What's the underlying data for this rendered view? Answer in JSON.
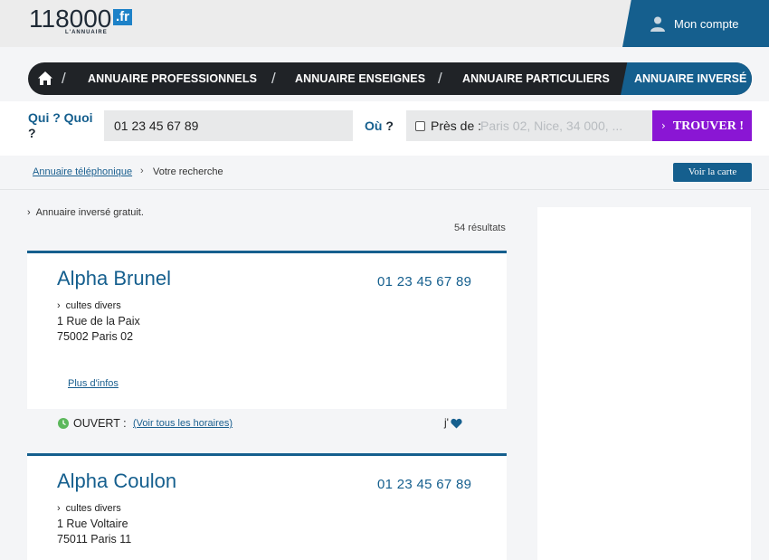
{
  "header": {
    "logo_digits": "118000",
    "logo_fr": ".fr",
    "logo_sub": "L'ANNUAIRE",
    "account_label": "Mon compte"
  },
  "nav": {
    "items": [
      "ANNUAIRE PROFESSIONNELS",
      "ANNUAIRE ENSEIGNES",
      "ANNUAIRE PARTICULIERS"
    ],
    "active": "ANNUAIRE INVERSÉ"
  },
  "search": {
    "qui_label_a": "Qui ?",
    "qui_label_b": "Quoi",
    "qui_label_c": "?",
    "qui_value": "01 23 45 67 89",
    "ou_label_a": "Où",
    "ou_label_b": "?",
    "pres_de": "Près de :",
    "ou_placeholder": "Paris 02, Nice, 34 000, ...",
    "button": "TROUVER !"
  },
  "breadcrumb": {
    "link": "Annuaire téléphonique",
    "current": "Votre recherche",
    "map_button": "Voir la carte"
  },
  "content": {
    "info": "Annuaire inversé gratuit.",
    "results": "54 résultats"
  },
  "cards": [
    {
      "name": "Alpha Brunel",
      "phone": "01 23 45 67 89",
      "category": "cultes divers",
      "address1": "1 Rue de la Paix",
      "address2": "75002 Paris 02",
      "more": "Plus d'infos",
      "status": "OUVERT :",
      "hours_link": "(Voir tous les horaires)",
      "fav": "j'"
    },
    {
      "name": "Alpha Coulon",
      "phone": "01 23 45 67 89",
      "category": "cultes divers",
      "address1": "1 Rue Voltaire",
      "address2": "75011 Paris 11"
    }
  ],
  "colors": {
    "brand_blue": "#155f8e",
    "nav_dark": "#202327",
    "cta_purple": "#8a16d4",
    "open_green": "#5cb85c"
  }
}
